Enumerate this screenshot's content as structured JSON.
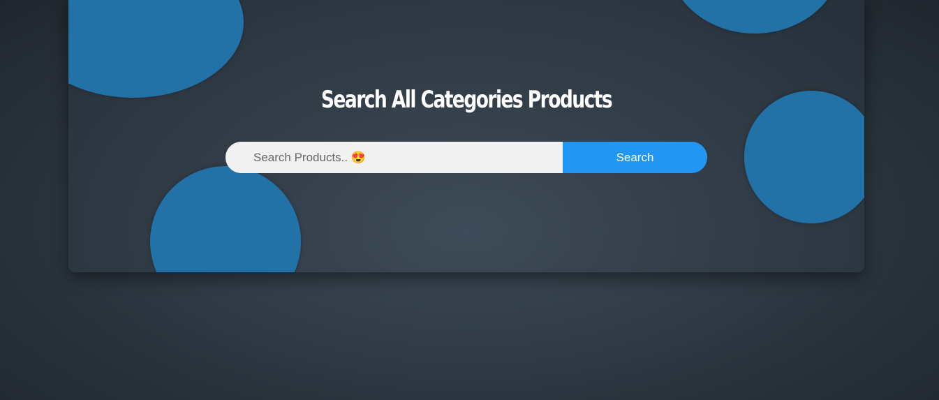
{
  "banner": {
    "title": "Search All Categories Products",
    "accent_color": "#2272a8"
  },
  "search": {
    "placeholder": "Search Products.. 😍",
    "value": "",
    "button_label": "Search",
    "button_color": "#2196f3"
  }
}
